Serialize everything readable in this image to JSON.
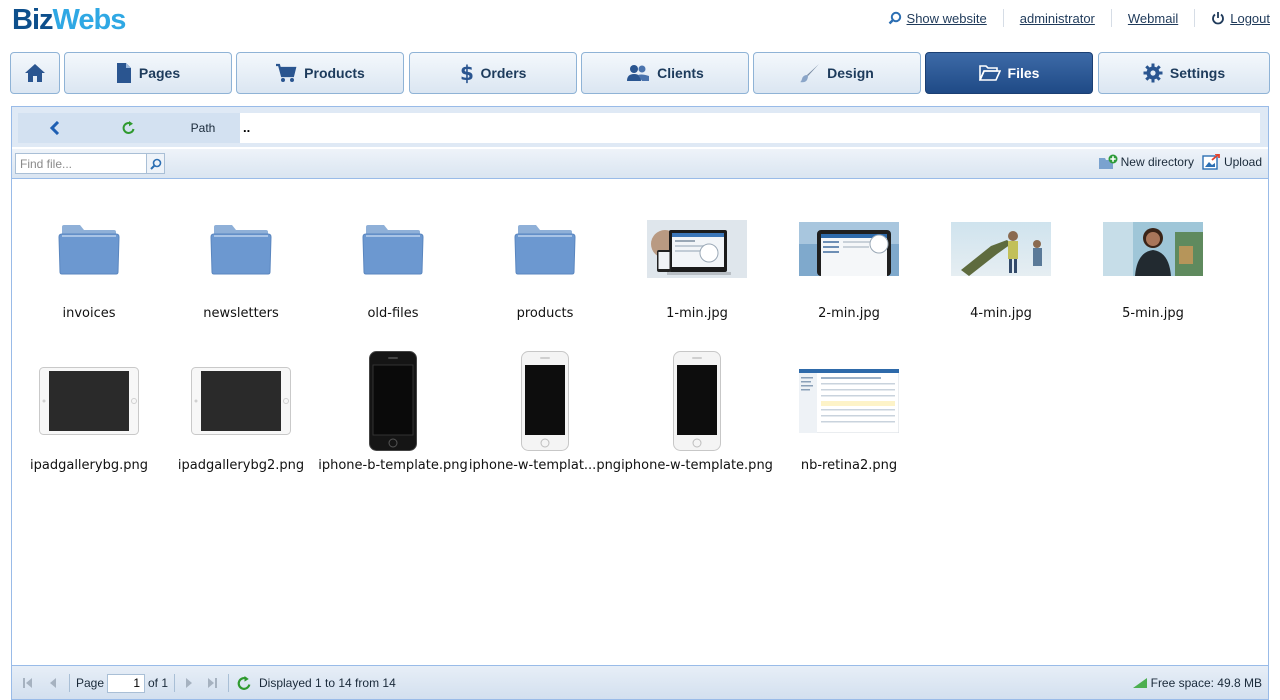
{
  "logo": {
    "part1": "Biz",
    "part2": "Webs"
  },
  "toplinks": {
    "show_website": "Show website",
    "user": "administrator",
    "webmail": "Webmail",
    "logout": "Logout"
  },
  "nav": {
    "tabs": [
      {
        "label": ""
      },
      {
        "label": "Pages"
      },
      {
        "label": "Products"
      },
      {
        "label": "Orders"
      },
      {
        "label": "Clients"
      },
      {
        "label": "Design"
      },
      {
        "label": "Files"
      },
      {
        "label": "Settings"
      }
    ],
    "active": "Files",
    "colors": {
      "active_bg": "#2a5590",
      "tab_bg": "#e6eef7",
      "accent": "#2fa8e4"
    }
  },
  "pathbar": {
    "path_label": "Path",
    "path_value": ".."
  },
  "toolbar": {
    "search_placeholder": "Find file...",
    "new_directory": "New directory",
    "upload": "Upload"
  },
  "files": [
    {
      "name": "invoices",
      "kind": "folder"
    },
    {
      "name": "newsletters",
      "kind": "folder"
    },
    {
      "name": "old-files",
      "kind": "folder"
    },
    {
      "name": "products",
      "kind": "folder"
    },
    {
      "name": "1-min.jpg",
      "kind": "photo-devices"
    },
    {
      "name": "2-min.jpg",
      "kind": "photo-tablet"
    },
    {
      "name": "4-min.jpg",
      "kind": "photo-people"
    },
    {
      "name": "5-min.jpg",
      "kind": "photo-woman"
    },
    {
      "name": "ipadgallerybg.png",
      "kind": "ipad"
    },
    {
      "name": "ipadgallerybg2.png",
      "kind": "ipad"
    },
    {
      "name": "iphone-b-template.png",
      "kind": "iphone-black"
    },
    {
      "name": "iphone-w-templat...png",
      "kind": "iphone-white"
    },
    {
      "name": "iphone-w-template.png",
      "kind": "iphone-white"
    },
    {
      "name": "nb-retina2.png",
      "kind": "screenshot"
    }
  ],
  "footer": {
    "page_label": "Page",
    "page_value": "1",
    "of_label": "of 1",
    "displayed": "Displayed 1 to 14 from 14",
    "free_space": "Free space: 49.8 MB"
  }
}
